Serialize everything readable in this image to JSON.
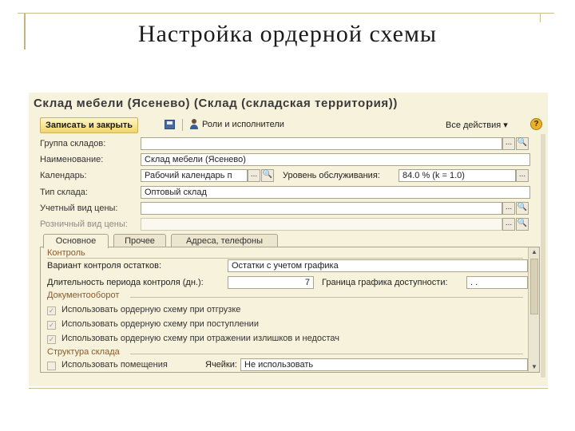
{
  "slide": {
    "title": "Настройка ордерной схемы"
  },
  "window": {
    "title": "Склад мебели (Ясенево) (Склад (складская территория))"
  },
  "toolbar": {
    "save_close": "Записать и закрыть",
    "roles": "Роли и исполнители",
    "all_actions": "Все действия ▾",
    "help": "?"
  },
  "form": {
    "group_label": "Группа складов:",
    "group_value": "",
    "name_label": "Наименование:",
    "name_value": "Склад мебели (Ясенево)",
    "calendar_label": "Календарь:",
    "calendar_value": "Рабочий календарь п",
    "service_label": "Уровень обслуживания:",
    "service_value": "84.0 % (k = 1.0)",
    "type_label": "Тип склада:",
    "type_value": "Оптовый склад",
    "account_price_label": "Учетный вид цены:",
    "account_price_value": "",
    "retail_price_label": "Розничный вид цены:",
    "retail_price_value": ""
  },
  "buttons": {
    "ellipsis": "...",
    "search": "🔍"
  },
  "tabs": [
    {
      "label": "Основное",
      "active": true
    },
    {
      "label": "Прочее",
      "active": false
    },
    {
      "label": "Адреса, телефоны",
      "active": false
    }
  ],
  "main_tab": {
    "control_section": "Контроль",
    "stock_control_label": "Вариант контроля остатков:",
    "stock_control_value": "Остатки с учетом графика",
    "period_label": "Длительность периода контроля (дн.):",
    "period_value": "7",
    "boundary_label": "Граница графика доступности:",
    "boundary_value": ". .",
    "docflow_section": "Документооборот",
    "checkboxes": [
      {
        "label": "Использовать ордерную схему при отгрузке",
        "checked": true
      },
      {
        "label": "Использовать ордерную схему при поступлении",
        "checked": true
      },
      {
        "label": "Использовать ордерную схему при отражении излишков и недостач",
        "checked": true
      },
      {
        "label": "Использовать помещения",
        "checked": false
      }
    ],
    "structure_section": "Структура склада",
    "cells_label": "Ячейки:",
    "cells_value": "Не использовать"
  },
  "colors": {
    "accent_section": "#8b5a2b",
    "window_bg": "#f7f2dc",
    "save_button": "#f3d56a"
  }
}
